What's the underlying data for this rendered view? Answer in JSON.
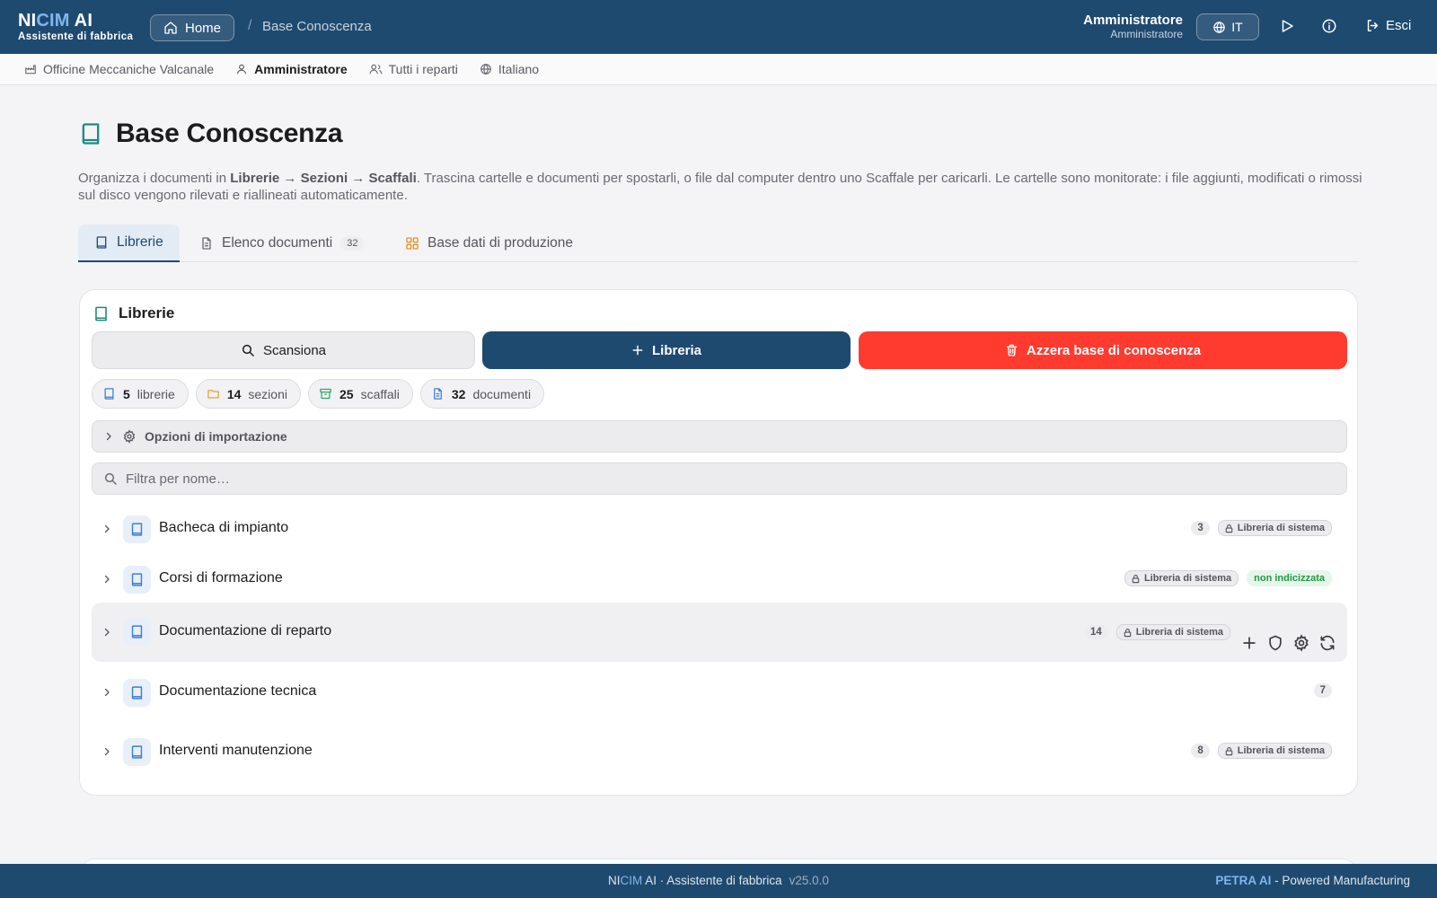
{
  "header": {
    "brand_pre": "NI",
    "brand_hl": "CIM",
    "brand_post": " AI",
    "brand_sub": "Assistente di fabbrica",
    "home_label": "Home",
    "breadcrumb_sep": "/",
    "breadcrumb_current": "Base Conoscenza",
    "user_name": "Amministratore",
    "user_role": "Amministratore",
    "language": "IT",
    "logout_label": "Esci"
  },
  "context": {
    "company": "Officine Meccaniche Valcanale",
    "user": "Amministratore",
    "department": "Tutti i reparti",
    "language": "Italiano"
  },
  "page": {
    "title": "Base Conoscenza",
    "desc_1": "Organizza i documenti in ",
    "desc_bold": "Librerie → Sezioni → Scaffali",
    "desc_2": ". Trascina cartelle e documenti per spostarli, o file dal computer dentro uno Scaffale per caricarli. Le cartelle sono monitorate: i file aggiunti, modificati o rimossi sul disco vengono rilevati e riallineati automaticamente."
  },
  "tabs": [
    {
      "label": "Librerie",
      "active": true
    },
    {
      "label": "Elenco documenti",
      "count": "32"
    },
    {
      "label": "Base dati di produzione"
    }
  ],
  "card": {
    "title": "Librerie",
    "scan_label": "Scansiona",
    "add_library_label": "Libreria",
    "reset_label": "Azzera base di conoscenza",
    "stats": [
      {
        "value": "5",
        "label": "librerie",
        "color": "#3d7fd1"
      },
      {
        "value": "14",
        "label": "sezioni",
        "color": "#f0a030"
      },
      {
        "value": "25",
        "label": "scaffali",
        "color": "#2ea86a"
      },
      {
        "value": "32",
        "label": "documenti",
        "color": "#3d7fd1"
      }
    ],
    "import_options_label": "Opzioni di importazione",
    "filter_placeholder": "Filtra per nome…",
    "system_badge": "Libreria di sistema",
    "not_indexed_badge": "non indicizzata",
    "libraries": [
      {
        "name": "Bacheca di impianto",
        "count": "3",
        "system": true
      },
      {
        "name": "Corsi di formazione",
        "system": true,
        "not_indexed": true
      },
      {
        "name": "Documentazione di reparto",
        "count": "14",
        "system": true,
        "hover": true
      },
      {
        "name": "Documentazione tecnica",
        "count": "7"
      },
      {
        "name": "Interventi manutenzione",
        "count": "8",
        "system": true
      }
    ]
  },
  "footer": {
    "brand_pre": "NI",
    "brand_hl": "CIM",
    "brand_post": " AI · Assistente di fabbrica",
    "version": "v25.0.0",
    "right_bold": "PETRA AI",
    "right_rest": " - Powered Manufacturing"
  },
  "colors": {
    "primary": "#1f4a70",
    "danger": "#ff3b30",
    "accent_teal": "#1e8a80"
  }
}
